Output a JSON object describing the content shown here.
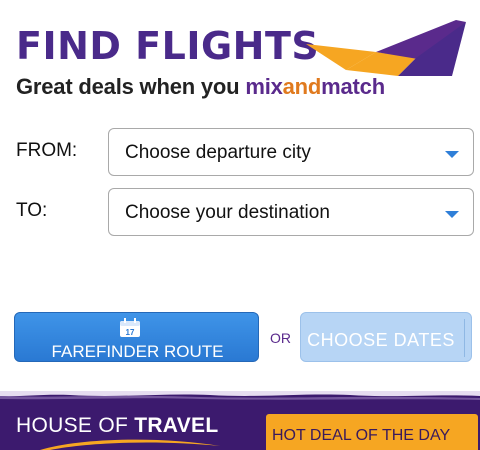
{
  "header": {
    "title": "FIND FLIGHTS",
    "tagline_prefix": "Great deals when you ",
    "brand_mix": "mix",
    "brand_and": "and",
    "brand_match": "match"
  },
  "form": {
    "from_label": "FROM:",
    "from_value": "Choose departure city",
    "to_label": "TO:",
    "to_value": "Choose your destination"
  },
  "actions": {
    "farefinder_calendar_day": "17",
    "farefinder_label": "FAREFINDER ROUTE",
    "or_text": "OR",
    "choose_dates_label": "CHOOSE DATES"
  },
  "banner": {
    "logo_light": "HOUSE OF ",
    "logo_bold": "TRAVEL",
    "hot_deal_label": "HOT DEAL OF THE DAY"
  },
  "colors": {
    "brand_purple": "#4a2a8a",
    "accent_orange": "#f6a622",
    "button_blue": "#2a79d3",
    "button_disabled_blue": "#b7d5f5",
    "banner_purple": "#3c1a6e"
  }
}
